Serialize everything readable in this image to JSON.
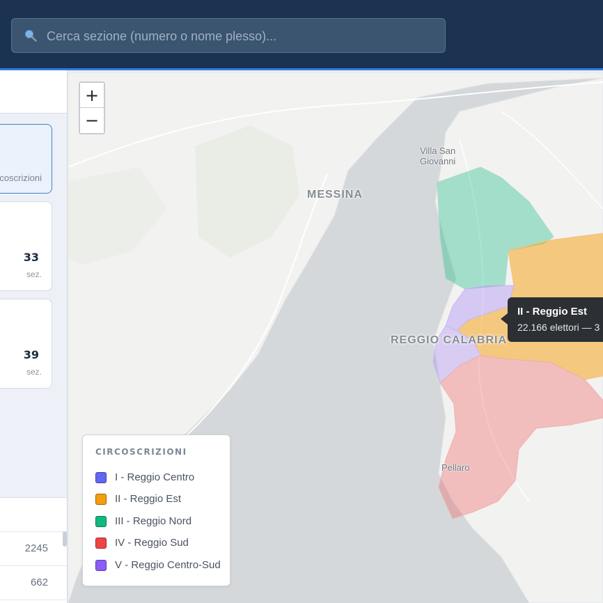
{
  "search": {
    "placeholder": "Cerca sezione (numero o nome plesso)..."
  },
  "sidebar": {
    "card_selected": {
      "subtitle": "coscrizioni"
    },
    "cards": [
      {
        "count": "33",
        "unit": "sez."
      },
      {
        "count": "39",
        "unit": "sez."
      }
    ],
    "rows": [
      "2245",
      "662"
    ]
  },
  "map": {
    "places": {
      "messina": "MESSINA",
      "villa": "Villa San\nGiovanni",
      "reggio": "REGGIO CALABRIA",
      "pellaro": "Pellaro"
    },
    "zoom": {
      "in": "+",
      "out": "−"
    },
    "tooltip": {
      "title": "II - Reggio Est",
      "detail": "22.166 elettori — 3"
    }
  },
  "legend": {
    "title": "CIRCOSCRIZIONI",
    "items": [
      {
        "label": "I - Reggio Centro",
        "color": "#6366f1"
      },
      {
        "label": "II - Reggio Est",
        "color": "#f59e0b"
      },
      {
        "label": "III - Reggio Nord",
        "color": "#10b981"
      },
      {
        "label": "IV - Reggio Sud",
        "color": "#ef4444"
      },
      {
        "label": "V - Reggio Centro-Sud",
        "color": "#8b5cf6"
      }
    ]
  }
}
